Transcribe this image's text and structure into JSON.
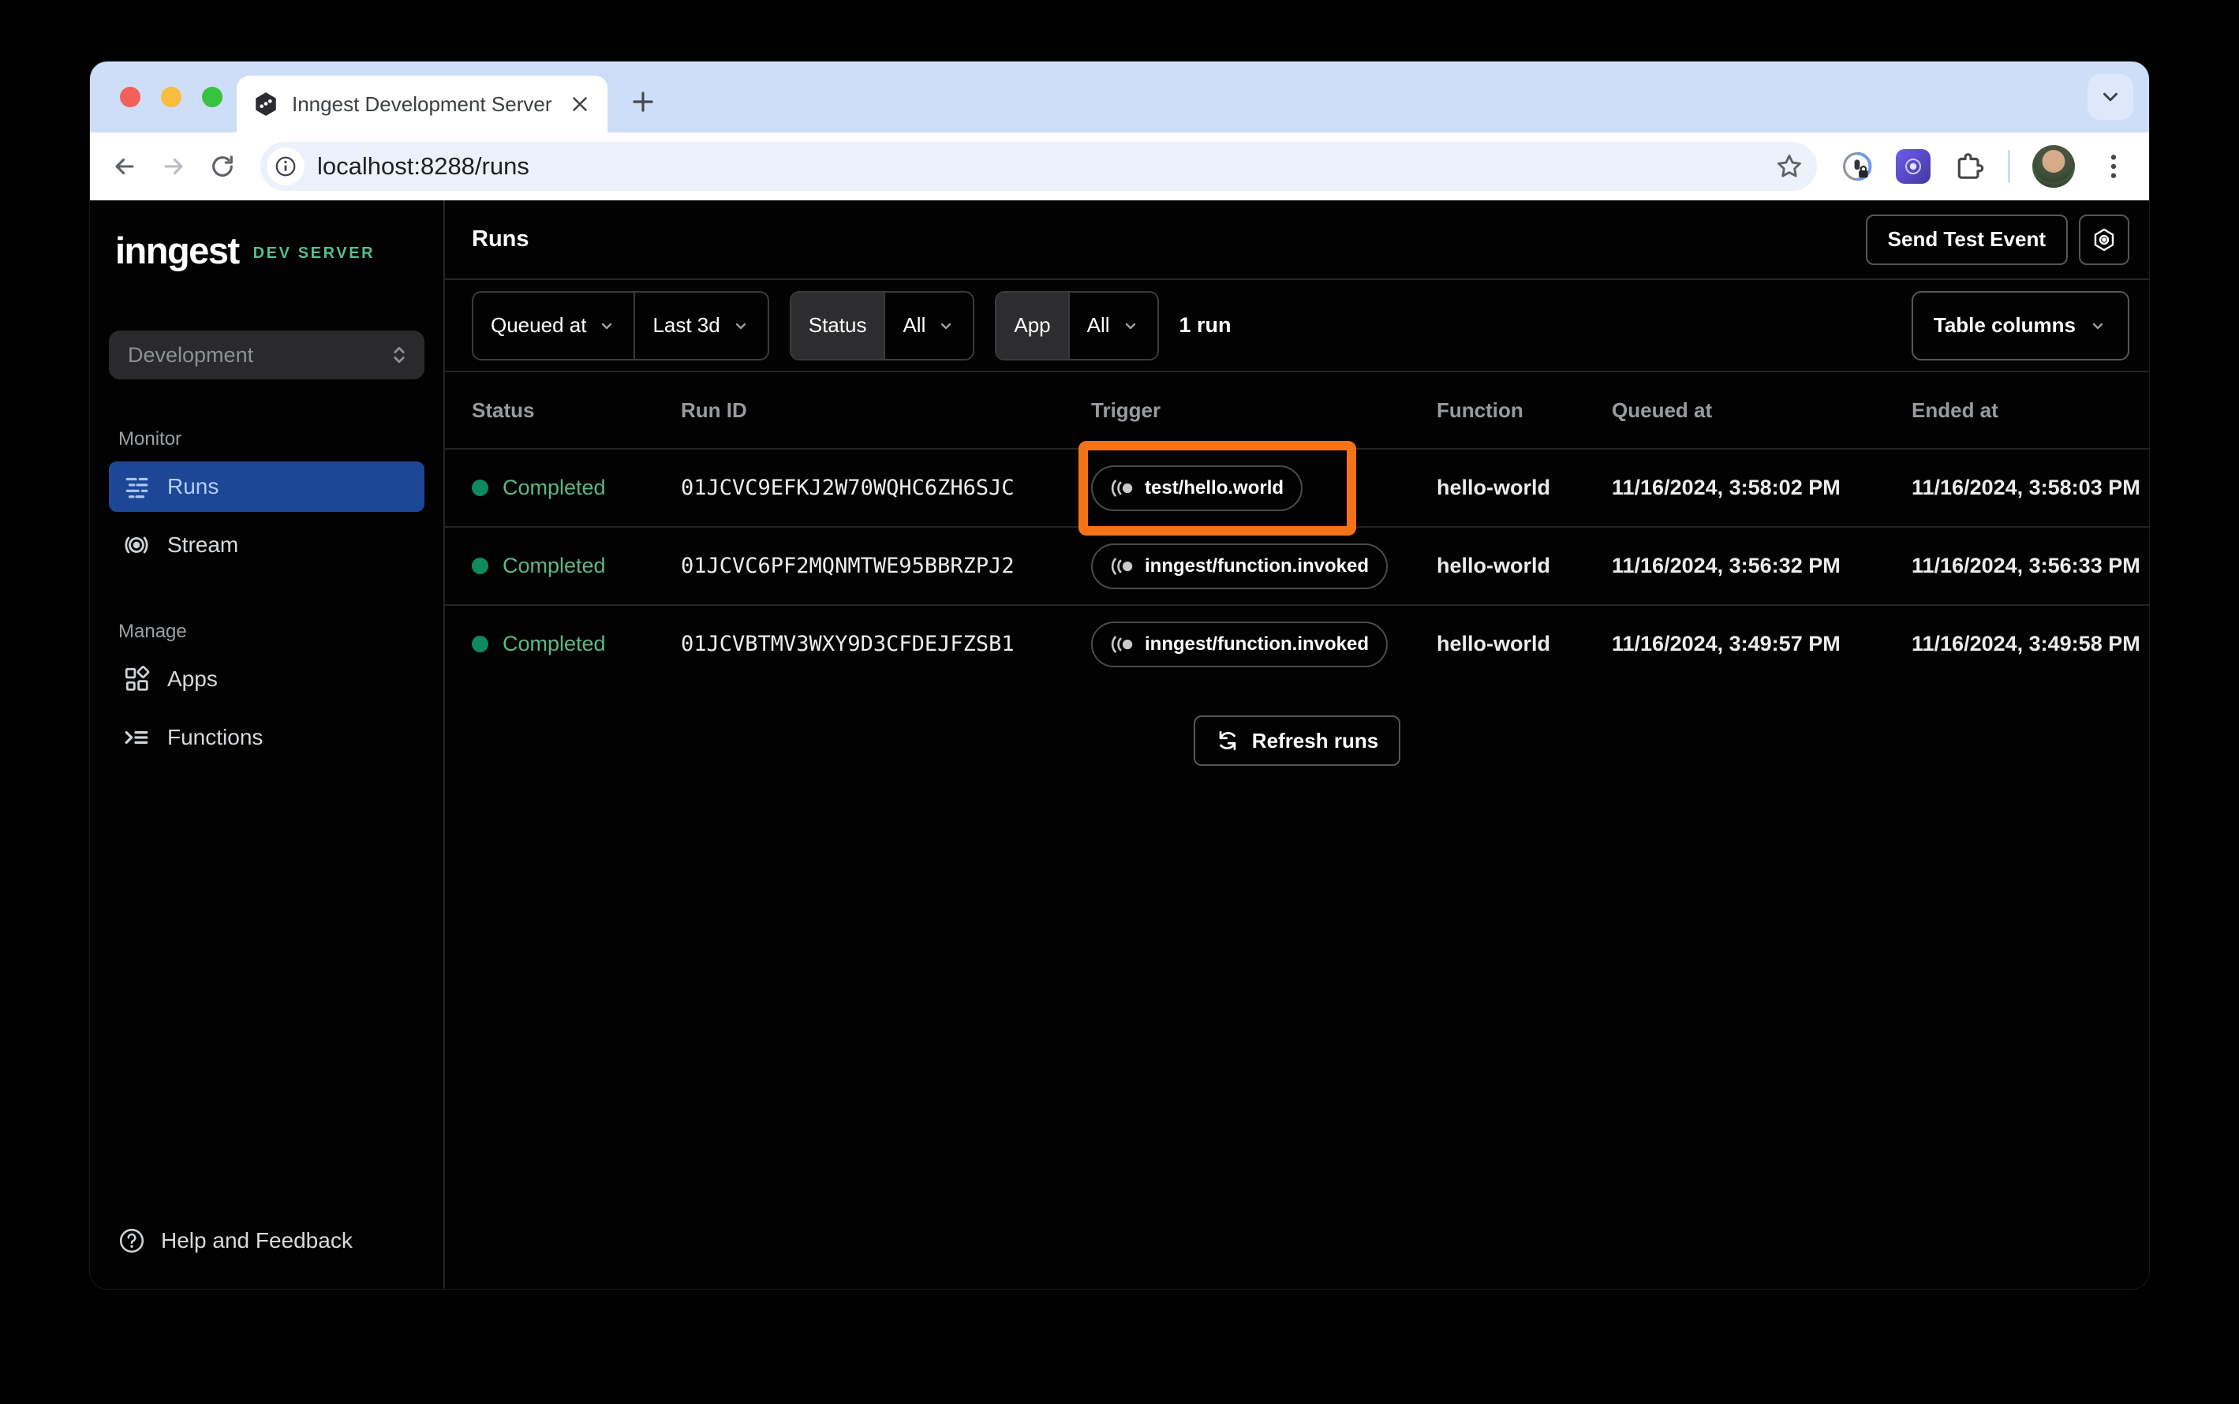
{
  "browser": {
    "tab_title": "Inngest Development Server",
    "url": "localhost:8288/runs"
  },
  "sidebar": {
    "logo": "inngest",
    "logo_badge": "DEV SERVER",
    "env_select": "Development",
    "sections": [
      {
        "label": "Monitor",
        "items": [
          {
            "label": "Runs",
            "icon": "runs-list-icon",
            "active": true
          },
          {
            "label": "Stream",
            "icon": "broadcast-icon",
            "active": false
          }
        ]
      },
      {
        "label": "Manage",
        "items": [
          {
            "label": "Apps",
            "icon": "apps-grid-icon",
            "active": false
          },
          {
            "label": "Functions",
            "icon": "functions-icon",
            "active": false
          }
        ]
      }
    ],
    "help_label": "Help and Feedback"
  },
  "header": {
    "title": "Runs",
    "send_test_event_label": "Send Test Event"
  },
  "filters": {
    "queued_at_label": "Queued at",
    "time_range": "Last 3d",
    "status_label": "Status",
    "status_value": "All",
    "app_label": "App",
    "app_value": "All",
    "run_count": "1 run",
    "table_columns_label": "Table columns"
  },
  "table": {
    "columns": [
      "Status",
      "Run ID",
      "Trigger",
      "Function",
      "Queued at",
      "Ended at"
    ],
    "rows": [
      {
        "status": "Completed",
        "run_id": "01JCVC9EFKJ2W70WQHC6ZH6SJC",
        "trigger": "test/hello.world",
        "function": "hello-world",
        "queued_at": "11/16/2024, 3:58:02 PM",
        "ended_at": "11/16/2024, 3:58:03 PM",
        "annotated": true
      },
      {
        "status": "Completed",
        "run_id": "01JCVC6PF2MQNMTWE95BBRZPJ2",
        "trigger": "inngest/function.invoked",
        "function": "hello-world",
        "queued_at": "11/16/2024, 3:56:32 PM",
        "ended_at": "11/16/2024, 3:56:33 PM",
        "annotated": false
      },
      {
        "status": "Completed",
        "run_id": "01JCVBTMV3WXY9D3CFDEJFZSB1",
        "trigger": "inngest/function.invoked",
        "function": "hello-world",
        "queued_at": "11/16/2024, 3:49:57 PM",
        "ended_at": "11/16/2024, 3:49:58 PM",
        "annotated": false
      }
    ],
    "refresh_label": "Refresh runs"
  },
  "colors": {
    "active_nav_blue": "#1d4796",
    "status_green_text": "#5cb885",
    "status_green_dot": "#0f8a5f",
    "dev_server_green": "#57bd90",
    "annotation_orange": "#f47318",
    "chrome_tabstrip_blue": "#cfdef8"
  },
  "icons": {
    "trigger": "event-pulse-icon",
    "settings": "hexagon-gear-icon",
    "refresh": "circular-arrows-icon",
    "help": "question-circle-icon"
  }
}
